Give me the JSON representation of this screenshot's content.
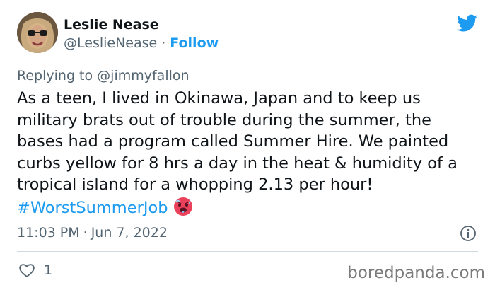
{
  "author": {
    "display_name": "Leslie Nease",
    "handle": "@LeslieNease",
    "separator": "·",
    "follow_label": "Follow"
  },
  "reply": {
    "prefix": "Replying to",
    "mention": "@jimmyfallon"
  },
  "tweet": {
    "text": "As a teen, I lived in Okinawa, Japan and to keep us military brats out of trouble during the summer, the bases had a program called Summer Hire. We painted curbs yellow for 8 hrs a day in the heat & humidity of a tropical island for a whopping 2.13 per hour! ",
    "hashtag": "#WorstSummerJob",
    "emoji": "hot-face"
  },
  "meta": {
    "time": "11:03 PM",
    "separator": "·",
    "date": "Jun 7, 2022"
  },
  "stats": {
    "likes": "1"
  },
  "watermark": "boredpanda.com",
  "colors": {
    "accent": "#1d9bf0",
    "text": "#0f1419",
    "secondary": "#536471",
    "divider": "#cfd9de"
  },
  "icons": [
    "twitter-bird-icon",
    "info-icon",
    "heart-icon",
    "hot-face-emoji"
  ]
}
